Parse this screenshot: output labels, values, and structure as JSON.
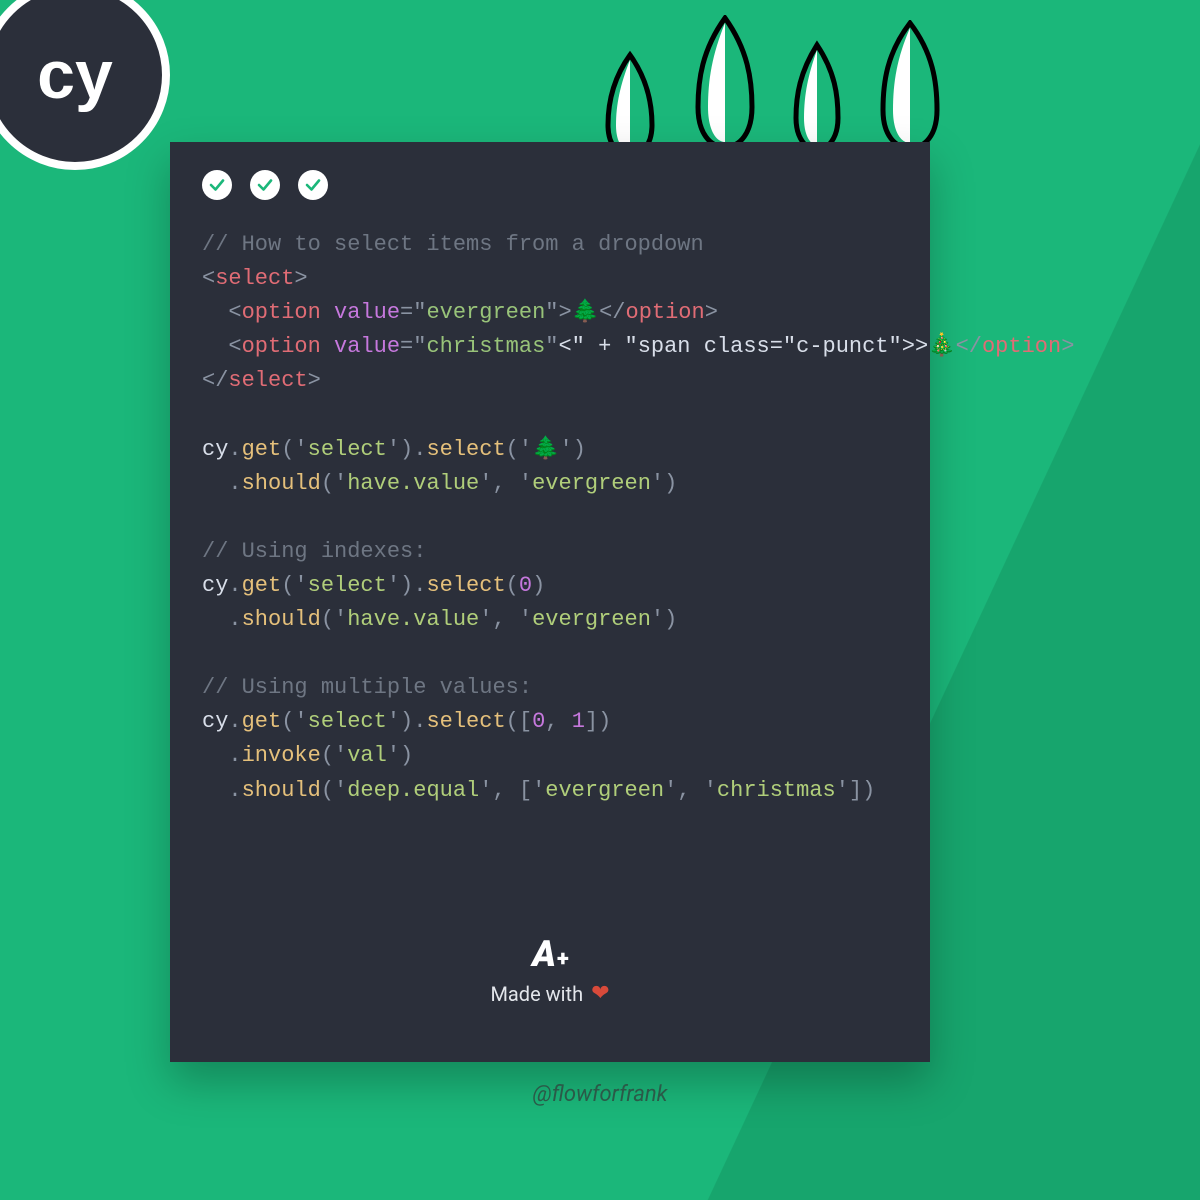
{
  "logo": {
    "text": "cy"
  },
  "code": {
    "comment1": "// How to select items from a dropdown",
    "selectOpen": "select",
    "optionTag": "option",
    "valueAttr": "value",
    "val_evergreen": "evergreen",
    "val_christmas": "christmas",
    "tree1": "🌲",
    "tree2": "🎄",
    "selectClose": "select",
    "cy": "cy",
    "get": "get",
    "select": "select",
    "should": "should",
    "invoke": "invoke",
    "sel_select": "select",
    "have_value": "have.value",
    "lit_evergreen": "evergreen",
    "comment2": "// Using indexes:",
    "zero": "0",
    "one": "1",
    "comment3": "// Using multiple values:",
    "val": "val",
    "deep_equal": "deep.equal",
    "lit_christmas": "christmas"
  },
  "footer": {
    "brand_a": "A",
    "brand_plus": "+",
    "madewith": "Made with",
    "handle": "@flowforfrank"
  }
}
